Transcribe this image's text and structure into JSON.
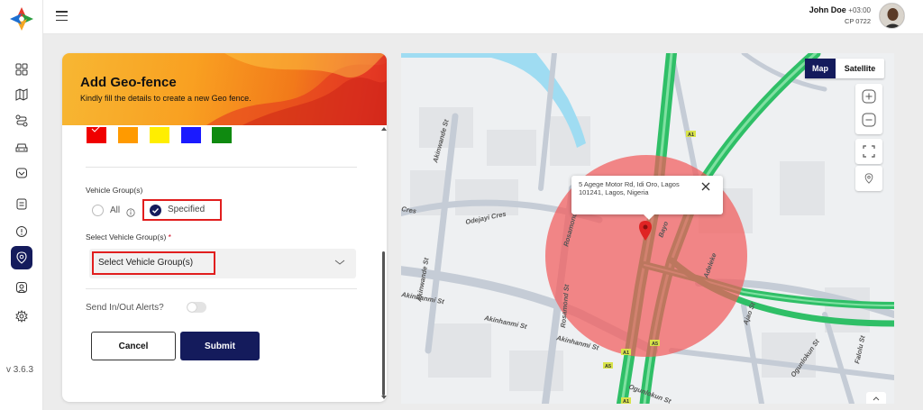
{
  "app": {
    "version": "v 3.6.3",
    "accent": "#141b5c"
  },
  "header": {
    "user_name": "John Doe",
    "timezone": "+03:00",
    "user_code": "CP 0722"
  },
  "sidebar": {
    "items": [
      {
        "icon": "dashboard-grid-icon"
      },
      {
        "icon": "map-icon"
      },
      {
        "icon": "route-icon"
      },
      {
        "icon": "car-icon"
      },
      {
        "icon": "tracker-icon"
      },
      {
        "icon": "clipboard-icon"
      },
      {
        "icon": "alert-icon"
      },
      {
        "icon": "geofence-pin-icon",
        "active": true
      },
      {
        "icon": "user-icon"
      },
      {
        "icon": "settings-icon"
      }
    ]
  },
  "form": {
    "title": "Add Geo-fence",
    "subtitle": "Kindly fill the details to create a new Geo fence.",
    "colors": [
      "#f00000",
      "#ff9a00",
      "#ffee00",
      "#1a1aff",
      "#0f8a10"
    ],
    "vehicle_group_label": "Vehicle Group(s)",
    "option_all": "All",
    "option_specified": "Specified",
    "select_label": "Select Vehicle Group(s)",
    "select_required": "*",
    "select_placeholder": "Select Vehicle Group(s)",
    "alerts_label": "Send In/Out Alerts?",
    "alerts_enabled": false,
    "cancel_label": "Cancel",
    "submit_label": "Submit"
  },
  "map": {
    "mode_map": "Map",
    "mode_satellite": "Satellite",
    "active_mode": "Map",
    "popup_address": "5 Agege Motor Rd, Idi Oro, Lagos 101241, Lagos, Nigeria",
    "street_labels": [
      "Akinwande St",
      "Odejayi Cres",
      "Cres",
      "Rosamond St",
      "Bayo",
      "Akinhanmi St",
      "Akinhanmi St",
      "Akinhanmi St",
      "Rosamond St",
      "Ogunlokun St",
      "Adeleke",
      "Ajao St",
      "Falolu St",
      "Ogunlokun St",
      "Akinwande St"
    ],
    "road_badges": [
      "A1",
      "A5",
      "A1",
      "A5",
      "A1"
    ]
  }
}
